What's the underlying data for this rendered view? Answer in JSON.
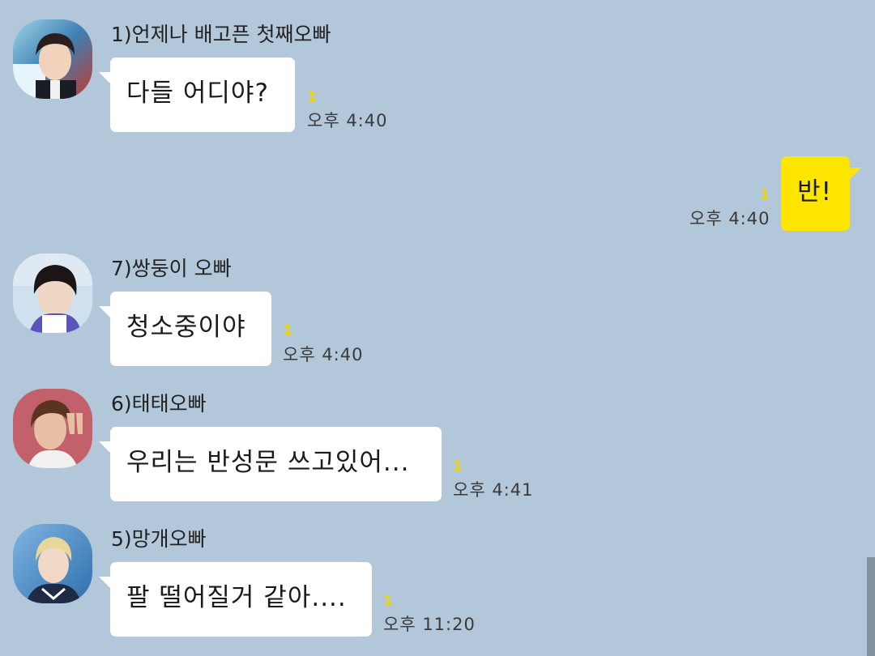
{
  "messages": [
    {
      "sender": "1)언제나 배고픈 첫째오빠",
      "text": "다들 어디야?",
      "unread": "1",
      "time": "오후 4:40",
      "avatar_icon": "profile-photo-red-blue-background"
    },
    {
      "sender": "",
      "text": "반!",
      "unread": "1",
      "time": "오후 4:40",
      "mine": true
    },
    {
      "sender": "7)쌍둥이 오빠",
      "text": "청소중이야",
      "unread": "1",
      "time": "오후 4:40",
      "avatar_icon": "profile-photo-dark-hair-purple-top"
    },
    {
      "sender": "6)태태오빠",
      "text": "우리는 반성문 쓰고있어...",
      "unread": "1",
      "time": "오후 4:41",
      "avatar_icon": "profile-photo-peace-sign-red-background"
    },
    {
      "sender": "5)망개오빠",
      "text": "팔 떨어질거 같아....",
      "unread": "1",
      "time": "오후 11:20",
      "avatar_icon": "profile-photo-light-hair-blue-background"
    }
  ],
  "colors": {
    "background": "#b2c7da",
    "my_bubble": "#fee500",
    "other_bubble": "#ffffff",
    "unread_count": "#f2d400"
  }
}
